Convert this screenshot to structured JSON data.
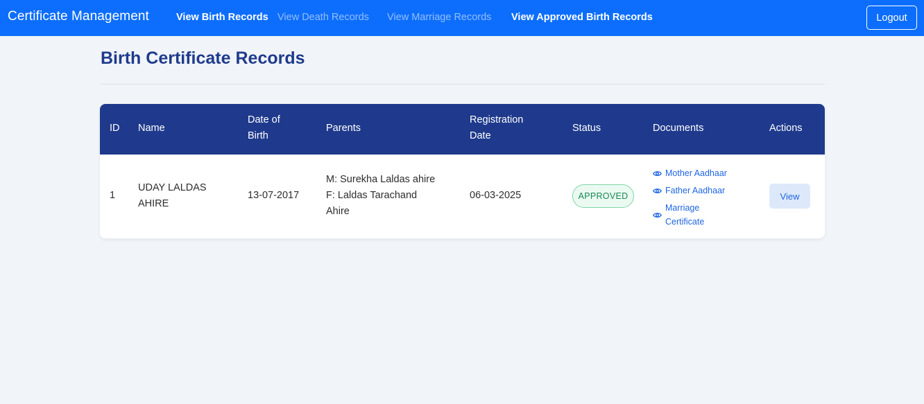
{
  "nav": {
    "brand": "Certificate Management",
    "links": [
      {
        "label": "View Birth Records",
        "state": "active"
      },
      {
        "label": "View Death Records",
        "state": "muted"
      },
      {
        "label": "View Marriage Records",
        "state": "muted"
      },
      {
        "label": "View Approved Birth Records",
        "state": "active"
      }
    ],
    "logout_label": "Logout"
  },
  "page": {
    "title": "Birth Certificate Records"
  },
  "table": {
    "headers": {
      "id": "ID",
      "name": "Name",
      "dob_line1": "Date of",
      "dob_line2": "Birth",
      "parents": "Parents",
      "reg_line1": "Registration",
      "reg_line2": "Date",
      "status": "Status",
      "documents": "Documents",
      "actions": "Actions"
    },
    "rows": [
      {
        "id": "1",
        "name_line1": "UDAY LALDAS",
        "name_line2": "AHIRE",
        "dob": "13-07-2017",
        "mother": "M: Surekha Laldas ahire",
        "father_line1": "F: Laldas Tarachand",
        "father_line2": "Ahire",
        "registration_date": "06-03-2025",
        "status": "APPROVED",
        "documents": {
          "mother_aadhaar": "Mother Aadhaar",
          "father_aadhaar": "Father Aadhaar",
          "marriage_line1": "Marriage",
          "marriage_line2": "Certificate"
        },
        "action_label": "View"
      }
    ]
  },
  "colors": {
    "navbar": "#0d6efd",
    "table_header": "#1f3a8c",
    "title": "#1f3b8c",
    "status_green": "#198754",
    "link_blue": "#1f66e0"
  }
}
